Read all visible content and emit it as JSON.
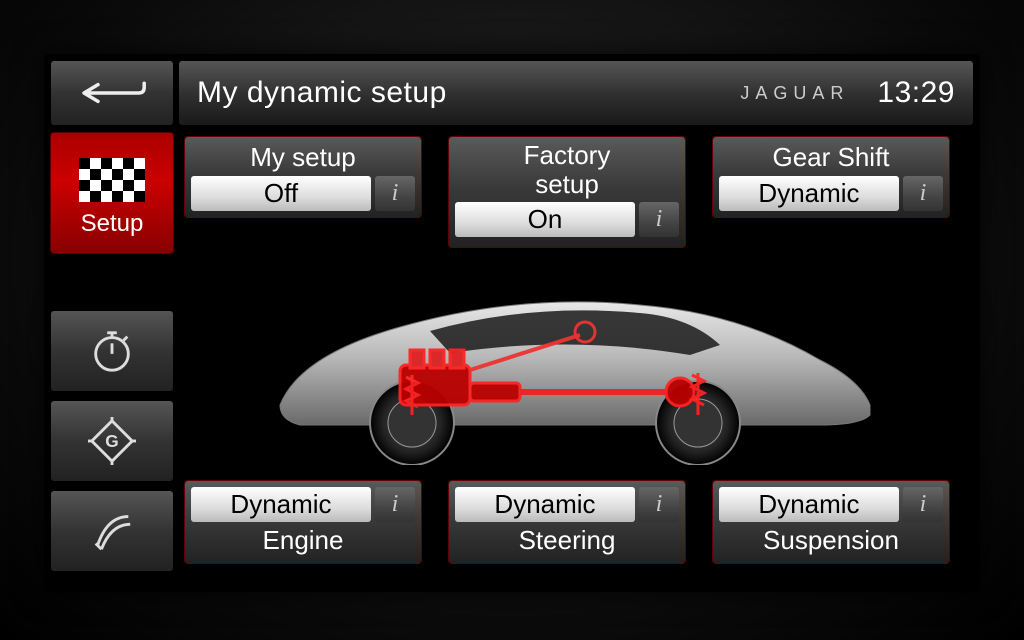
{
  "header": {
    "title": "My dynamic setup",
    "brand": "JAGUAR",
    "clock": "13:29"
  },
  "sidebar": {
    "setup_label": "Setup"
  },
  "cards": {
    "my_setup": {
      "title": "My setup",
      "value": "Off",
      "info": "i"
    },
    "factory_setup": {
      "title": "Factory\nsetup",
      "value": "On",
      "info": "i"
    },
    "gear_shift": {
      "title": "Gear Shift",
      "value": "Dynamic",
      "info": "i"
    },
    "engine": {
      "title": "Engine",
      "value": "Dynamic",
      "info": "i"
    },
    "steering": {
      "title": "Steering",
      "value": "Dynamic",
      "info": "i"
    },
    "suspension": {
      "title": "Suspension",
      "value": "Dynamic",
      "info": "i"
    }
  }
}
